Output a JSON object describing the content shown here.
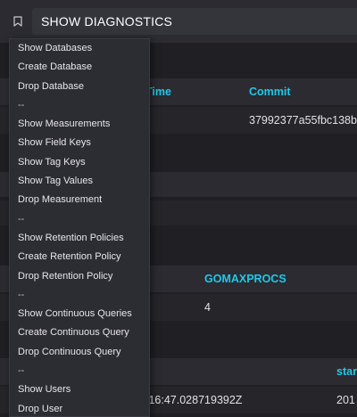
{
  "query": {
    "text": "SHOW DIAGNOSTICS",
    "bookmark_icon": "bookmark-icon"
  },
  "menu": {
    "items": [
      "Show Databases",
      "Create Database",
      "Drop Database",
      "--",
      "Show Measurements",
      "Show Field Keys",
      "Show Tag Keys",
      "Show Tag Values",
      "Drop Measurement",
      "--",
      "Show Retention Policies",
      "Create Retention Policy",
      "Drop Retention Policy",
      "--",
      "Show Continuous Queries",
      "Create Continuous Query",
      "Drop Continuous Query",
      "--",
      "Show Users",
      "Drop User"
    ]
  },
  "results": {
    "table1": {
      "headers": [
        "Time",
        "Commit"
      ],
      "row": [
        "",
        "37992377a55fbc138b"
      ]
    },
    "table2": {
      "headers": [
        "GOMAXPROCS"
      ],
      "row": [
        "4"
      ]
    },
    "table3": {
      "headers": [
        "star"
      ],
      "row": [
        ":16:47.028719392Z",
        "201"
      ]
    }
  },
  "colors": {
    "accent": "#22c7e8",
    "background": "#1f1f24",
    "menu_bg": "#2c2c33"
  }
}
